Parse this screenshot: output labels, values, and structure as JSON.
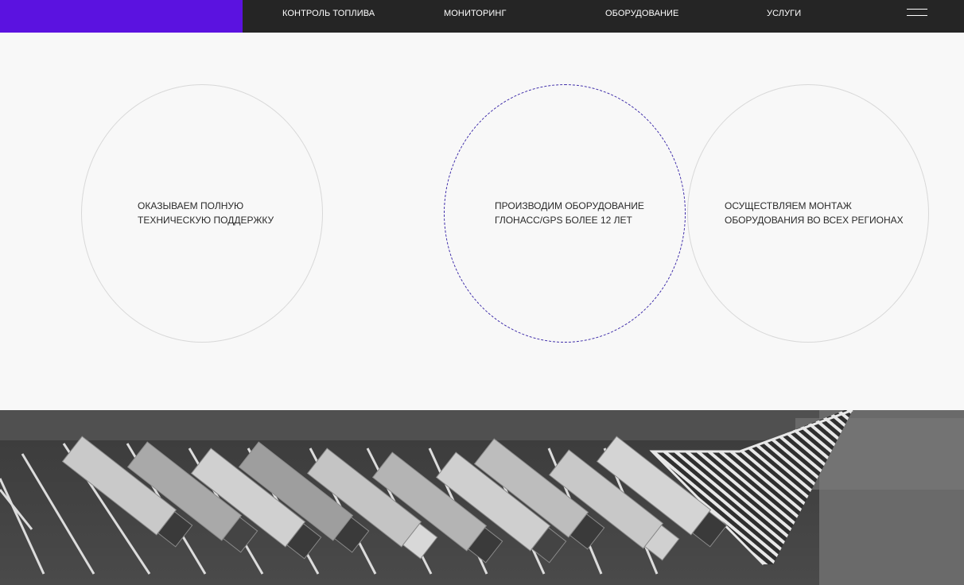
{
  "header": {
    "nav": [
      {
        "label": "КОНТРОЛЬ ТОПЛИВА"
      },
      {
        "label": "МОНИТОРИНГ"
      },
      {
        "label": "ОБОРУДОВАНИЕ"
      },
      {
        "label": "УСЛУГИ"
      }
    ],
    "brand_color": "#5b12e0",
    "menu_icon": "hamburger-menu-icon"
  },
  "features": [
    {
      "line1": "ОКАЗЫВАЕМ ПОЛНУЮ",
      "line2": "ТЕХНИЧЕСКУЮ ПОДДЕРЖКУ"
    },
    {
      "line1": "ПРОИЗВОДИМ ОБОРУДОВАНИЕ",
      "line2": "ГЛОНАСС/GPS БОЛЕЕ 12 ЛЕТ"
    },
    {
      "line1": "ОСУЩЕСТВЛЯЕМ МОНТАЖ",
      "line2": "ОБОРУДОВАНИЯ ВО ВСЕХ РЕГИОНАХ"
    }
  ],
  "colors": {
    "accent": "#5b12e0",
    "dashed_circle": "#3c2aa8",
    "header_bg": "#252525",
    "page_bg": "#f8f8f8"
  }
}
